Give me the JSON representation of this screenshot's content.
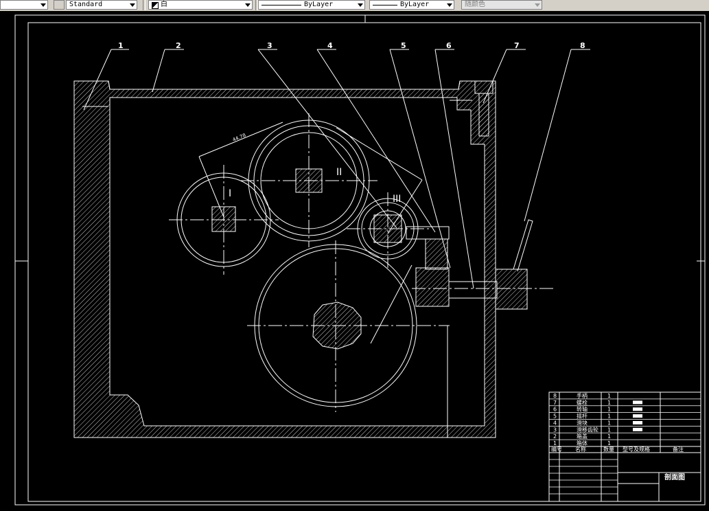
{
  "toolbar": {
    "text_style": "Standard",
    "color": "白",
    "linetype": "ByLayer",
    "lineweight": "ByLayer",
    "plot_style": "随颜色"
  },
  "drawing": {
    "balloons": [
      "1",
      "2",
      "3",
      "4",
      "5",
      "6",
      "7",
      "8"
    ],
    "shaft_labels": [
      "I",
      "II",
      "III"
    ],
    "dim_text": "44.78"
  },
  "bom": {
    "rows": [
      {
        "no": "8",
        "name": "手柄",
        "qty": "1"
      },
      {
        "no": "7",
        "name": "螺栓",
        "qty": "1"
      },
      {
        "no": "6",
        "name": "转轴",
        "qty": "1"
      },
      {
        "no": "5",
        "name": "摇杆",
        "qty": "1"
      },
      {
        "no": "4",
        "name": "滑块",
        "qty": "1"
      },
      {
        "no": "3",
        "name": "滑移齿轮",
        "qty": "1"
      },
      {
        "no": "2",
        "name": "箱盖",
        "qty": "1"
      },
      {
        "no": "1",
        "name": "箱体",
        "qty": "1"
      }
    ],
    "headers": [
      "编号",
      "名称",
      "数量",
      "型号及规格",
      "备注"
    ],
    "title": "剖面图"
  }
}
